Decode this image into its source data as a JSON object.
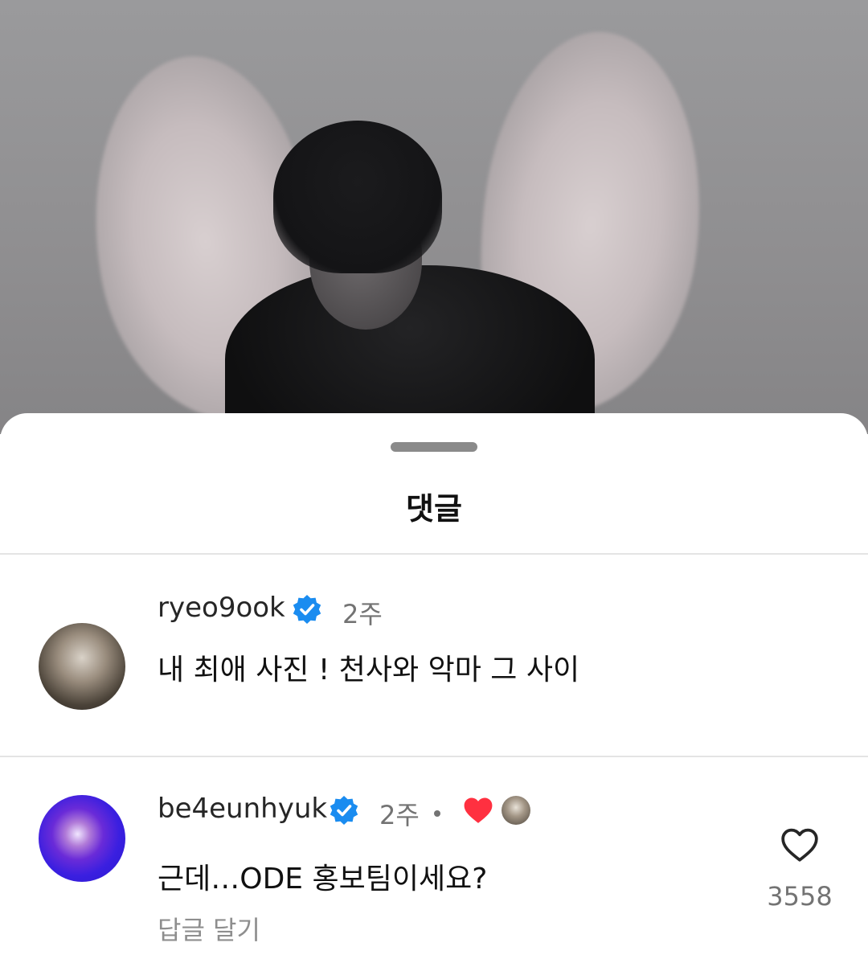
{
  "sheet": {
    "title": "댓글"
  },
  "comments": [
    {
      "username": "ryeo9ook",
      "verified": true,
      "time": "2주",
      "text": "내 최애 사진 ! 천사와 악마 그 사이"
    },
    {
      "username": "be4eunhyuk",
      "verified": true,
      "time": "2주",
      "text": "근데…ODE 홍보팀이세요?",
      "reply_label": "답글 달기",
      "like_count": "3558"
    }
  ],
  "icons": {
    "verified": "verified-badge-icon",
    "liked_by_author": "heart-filled-icon",
    "like": "heart-outline-icon"
  },
  "colors": {
    "verified_blue": "#1a8cf0",
    "heart_red": "#ff3040",
    "secondary_text": "#737373"
  }
}
